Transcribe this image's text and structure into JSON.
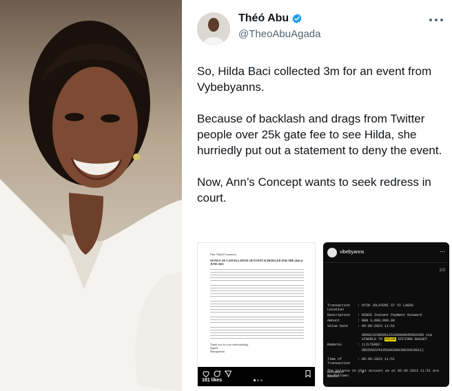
{
  "photo": {
    "alt_icon": "portrait-photo",
    "colors": {
      "hair": "#1c120d",
      "skin": "#7a4a32",
      "shirt": "#f4f2ef"
    }
  },
  "tweet": {
    "author_name": "Théó Abu",
    "author_handle": "@TheoAbuAgada",
    "verified_color": "#1d9bf0",
    "paragraphs": [
      "So, Hilda Baci collected 3m for an event from Vybebyanns.",
      "Because of backlash and drags from Twitter people over 25k gate fee to see Hilda, she hurriedly put out a statement to deny the event.",
      "Now, Ann’s Concept wants to seek redress in court."
    ]
  },
  "letter": {
    "salutation": "Dear Valued Customers,",
    "heading": "NOTICE OF CANCELLATION OF EVENT SCHEDULED FOR THE 24th of JUNE 2023",
    "closing_lines": [
      "Thank you for your understanding.",
      "Signed",
      "Management"
    ],
    "likes": "181 likes"
  },
  "receipt": {
    "account": "vibebyanns",
    "more": "...",
    "page": "2/3",
    "rows": [
      {
        "k": "Transaction Location",
        "v": "OYIN JOLAYEMI ST VI LAGOS"
      },
      {
        "k": "Description",
        "v": "NIBSS Instant Payment Outward"
      },
      {
        "k": "Amount",
        "v": "NGN 3,000,000.00"
      },
      {
        "k": "Value Date",
        "v": "06-06-2023 11:51"
      },
      {
        "k": "",
        "v": "000013230606115106000045693398 via GTWORLD TO HILDA EFFIONG BASSEY"
      },
      {
        "k": "Remarks",
        "v": "(LILTEREF:"
      },
      {
        "k": "",
        "v": "DR2560224195S00390C00C03C0811)"
      },
      {
        "k": "Time of Transaction",
        "v": "06-06-2023 11:51"
      },
      {
        "k": "Document Number",
        "v": "0"
      }
    ],
    "footer": "The balance on this account as at 06-06-2023 11:51 are as follows:"
  }
}
